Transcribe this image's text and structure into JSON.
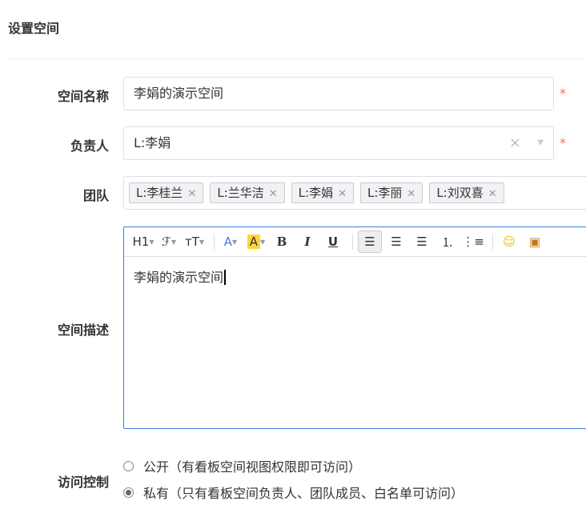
{
  "page": {
    "title": "设置空间"
  },
  "form": {
    "name": {
      "label": "空间名称",
      "value": "李娟的演示空间"
    },
    "owner": {
      "label": "负责人",
      "value": "L:李娟"
    },
    "team": {
      "label": "团队",
      "tags": [
        "L:李桂兰",
        "L:兰华洁",
        "L:李娟",
        "L:李丽",
        "L:刘双喜"
      ]
    },
    "desc": {
      "label": "空间描述",
      "content": "李娟的演示空间",
      "toolbar": [
        "H1",
        "ℱ",
        "ᴛT",
        "A",
        "A",
        "B",
        "I",
        "U"
      ]
    },
    "access": {
      "label": "访问控制",
      "options": [
        {
          "label": "公开（有看板空间视图权限即可访问）",
          "checked": false
        },
        {
          "label": "私有（只有看板空间负责人、团队成员、白名单可访问）",
          "checked": true
        }
      ]
    },
    "required_mark": "*"
  },
  "colors": {
    "accent": "#3a7ee8",
    "required": "#f56c6c",
    "highlight": "#ffd43b"
  }
}
